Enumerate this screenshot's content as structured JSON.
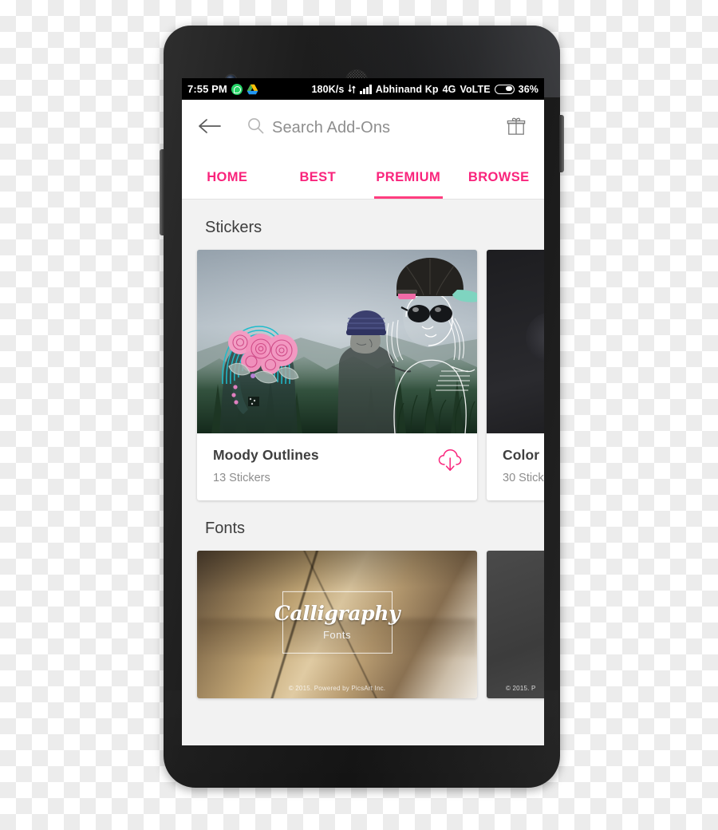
{
  "device": {
    "name": "android-smartphone",
    "hardware": {
      "front_camera": "front-camera",
      "earpiece": "earpiece-speaker",
      "volume_button": "volume-rocker",
      "power_button": "power-button"
    }
  },
  "status_bar": {
    "time": "7:55 PM",
    "app_icons": [
      "whatsapp-icon",
      "google-drive-icon"
    ],
    "network_speed": "180K/s",
    "data_sync_icon": "data-transfer-icon",
    "signal_icon": "signal-bars-icon",
    "carrier": "Abhinand Kp",
    "network_type": "4G",
    "volte": "VoLTE",
    "battery_icon": "battery-icon",
    "battery_percent": "36%"
  },
  "app_bar": {
    "back_icon": "back-arrow-icon",
    "search_icon": "search-icon",
    "search_value": "",
    "search_placeholder": "Search Add-Ons",
    "gift_icon": "gift-icon"
  },
  "tabs": [
    {
      "label": "HOME",
      "active": false
    },
    {
      "label": "BEST",
      "active": false
    },
    {
      "label": "PREMIUM",
      "active": true
    },
    {
      "label": "BROWSE",
      "active": false
    }
  ],
  "sections": [
    {
      "title": "Stickers",
      "cards": [
        {
          "title": "Moody Outlines",
          "subtitle": "13 Stickers",
          "download_icon": "cloud-download-icon",
          "artwork": "moody-outlines-illustration"
        },
        {
          "title": "Color ",
          "subtitle": "30 Stick",
          "download_icon": "cloud-download-icon",
          "artwork": "dark-sticker-pack-preview"
        }
      ]
    },
    {
      "title": "Fonts",
      "cards": [
        {
          "preview_word": "Calligraphy",
          "preview_sub": "Fonts",
          "copyright": "© 2015. Powered by PicsArt Inc.",
          "artwork": "calligraphy-fonts-preview"
        },
        {
          "preview_word": "",
          "preview_sub": "",
          "copyright": "© 2015. P",
          "artwork": "dark-fonts-preview"
        }
      ]
    }
  ],
  "colors": {
    "accent_pink": "#f9247c",
    "tab_underline": "#ff3d7f",
    "content_bg": "#f2f2f2",
    "card_bg": "#ffffff",
    "title_text": "#3f3f3f",
    "subtitle_text": "#8d8d8d",
    "status_bar_bg": "#000000"
  }
}
